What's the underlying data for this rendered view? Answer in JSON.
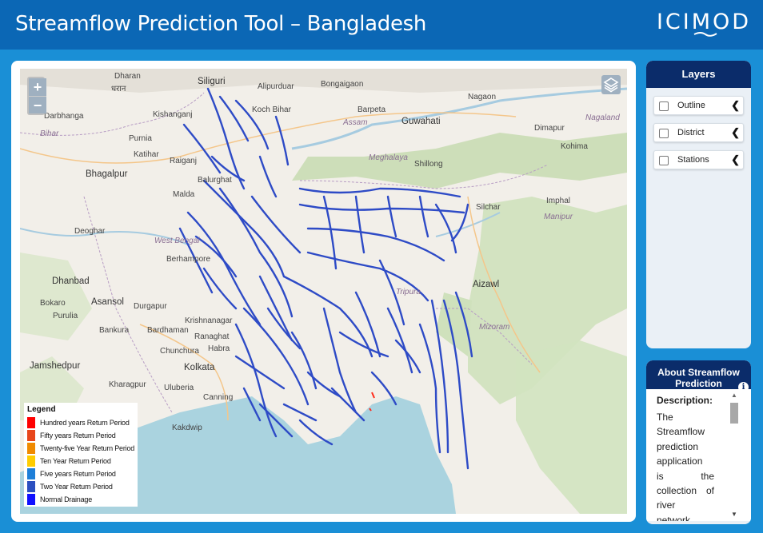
{
  "header": {
    "title": "Streamflow Prediction Tool – Bangladesh",
    "logo_text": "ICIMOD"
  },
  "map": {
    "zoom_in_label": "+",
    "zoom_out_label": "−",
    "place_labels": [
      "Dharan",
      "धरान",
      "Siliguri",
      "Alipurduar",
      "Bongaigaon",
      "Nagaon",
      "Darbhanga",
      "Kishanganj",
      "Koch Bihar",
      "Barpeta",
      "Guwahati",
      "Assam",
      "Bihar",
      "Purnia",
      "Dimapur",
      "Nagaland",
      "Katihar",
      "Raiganj",
      "Meghalaya",
      "Shillong",
      "Kohima",
      "Bhagalpur",
      "Balurghat",
      "Imphal",
      "Manipur",
      "Silchar",
      "Malda",
      "Deoghar",
      "West Bengal",
      "Berhampore",
      "Dhanbad",
      "Tripura",
      "Aizawl",
      "Bokaro",
      "Asansol",
      "Durgapur",
      "Purulia",
      "Bankura",
      "Bardhaman",
      "Mizoram",
      "Krishnanagar",
      "Ranaghat",
      "Habra",
      "Chunchura",
      "Jamshedpur",
      "Kolkata",
      "Kharagpur",
      "Uluberia",
      "Canning",
      "Kakdwip"
    ],
    "legend": {
      "title": "Legend",
      "items": [
        {
          "label": "Hundred years Return Period",
          "color": "#ff0000"
        },
        {
          "label": "Fifty years Return Period",
          "color": "#e8461a"
        },
        {
          "label": "Twenty-five Year Return Period",
          "color": "#f08a00"
        },
        {
          "label": "Ten Year Return Period",
          "color": "#ffcc00"
        },
        {
          "label": "Five years Return Period",
          "color": "#1e7fd8"
        },
        {
          "label": "Two Year Return Period",
          "color": "#2b4fc0"
        },
        {
          "label": "Normal Drainage",
          "color": "#1010ff"
        }
      ]
    }
  },
  "layers": {
    "title": "Layers",
    "items": [
      {
        "label": "Outline"
      },
      {
        "label": "District"
      },
      {
        "label": "Stations"
      }
    ]
  },
  "about": {
    "title": "About Streamflow Prediction",
    "description_label": "Description:",
    "description_lines": [
      "The",
      "Streamflow",
      "prediction",
      "application",
      "is the",
      "collection of",
      "river",
      "network"
    ]
  },
  "colors": {
    "header_bg": "#0b67b5",
    "page_bg": "#1a8fd6",
    "panel_head": "#0b2c6a",
    "river": "#2e4bc6"
  }
}
